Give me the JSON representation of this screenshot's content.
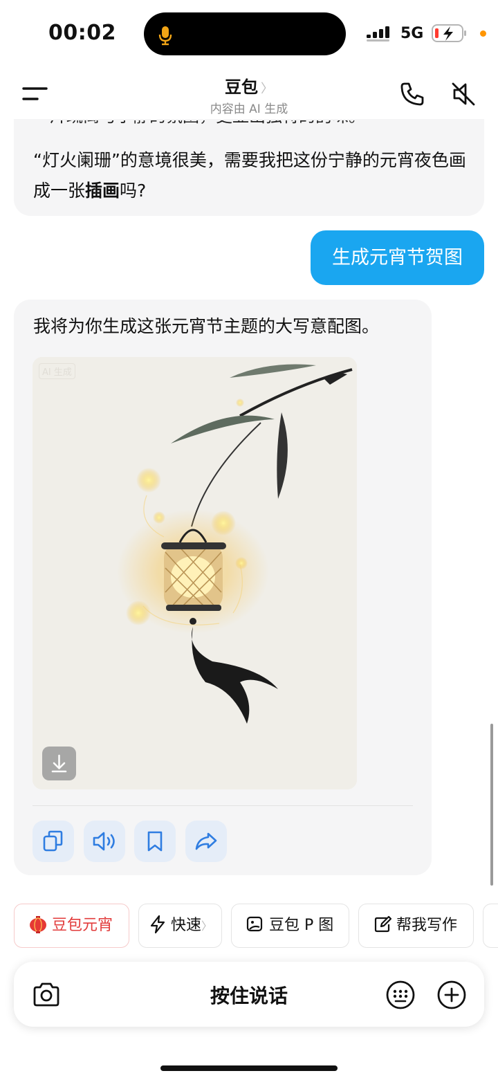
{
  "status_bar": {
    "time": "00:02",
    "network": "5G"
  },
  "header": {
    "title": "豆包",
    "title_chevron": "〉",
    "subtitle": "内容由 AI 生成"
  },
  "messages": {
    "bot1": {
      "cut_line": "一片疏离与宁静的氛围，更显出独特的韵味。",
      "text_before": "“灯火阑珊”的意境很美，需要我把这份宁静的元宵夜色画成一张",
      "text_bold": "插画",
      "text_after": "吗?"
    },
    "user1": {
      "text": "生成元宵节贺图"
    },
    "bot2": {
      "text": "我将为你生成这张元宵节主题的大写意配图。",
      "ai_badge": "AI 生成"
    }
  },
  "quick_chips": [
    {
      "label": "豆包元宵",
      "icon": "lantern-icon"
    },
    {
      "label": "快速",
      "chevron": "〉",
      "icon": "lightning-icon"
    },
    {
      "label": "豆包 P 图",
      "icon": "image-edit-icon"
    },
    {
      "label": "帮我写作",
      "icon": "pen-icon"
    }
  ],
  "input": {
    "hold_to_talk": "按住说话"
  },
  "colors": {
    "accent_blue": "#1aa6f0",
    "action_icon": "#2f7de1",
    "red_chip": "#e23b3b"
  }
}
